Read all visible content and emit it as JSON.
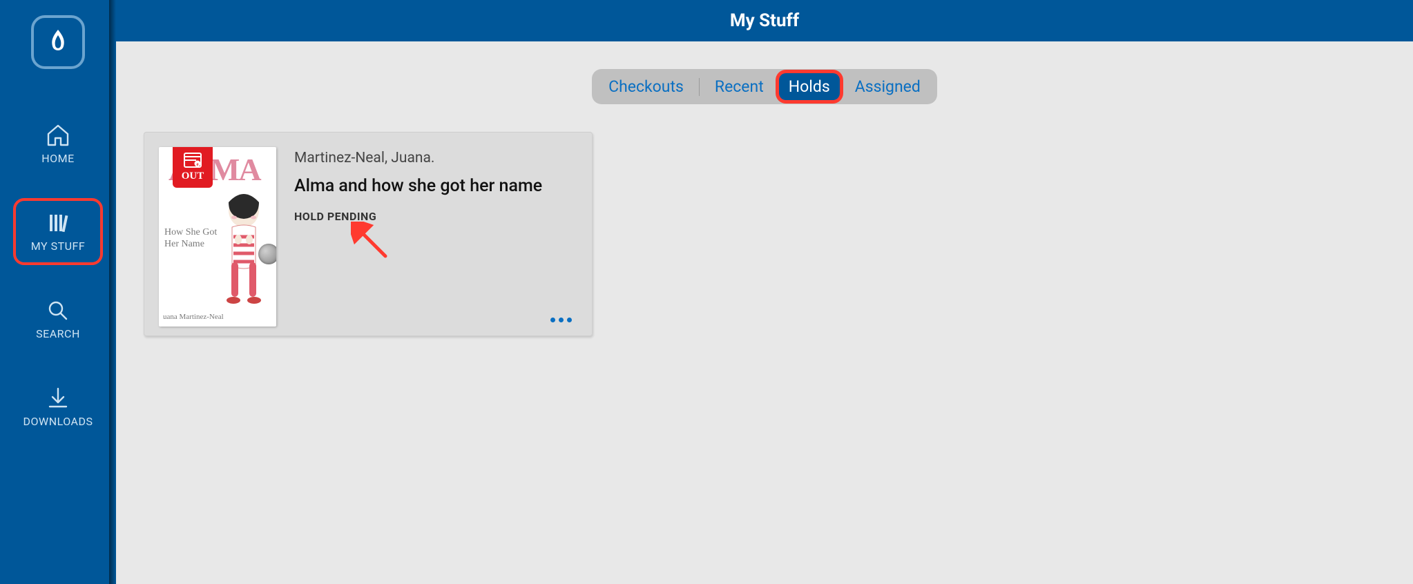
{
  "header": {
    "title": "My Stuff"
  },
  "sidebar": {
    "items": [
      {
        "id": "home",
        "label": "HOME"
      },
      {
        "id": "mystuff",
        "label": "MY STUFF"
      },
      {
        "id": "search",
        "label": "SEARCH"
      },
      {
        "id": "downloads",
        "label": "DOWNLOADS"
      }
    ],
    "active": "mystuff"
  },
  "tabs": {
    "items": [
      {
        "id": "checkouts",
        "label": "Checkouts"
      },
      {
        "id": "recent",
        "label": "Recent"
      },
      {
        "id": "holds",
        "label": "Holds"
      },
      {
        "id": "assigned",
        "label": "Assigned"
      }
    ],
    "active": "holds"
  },
  "hold": {
    "badge": "OUT",
    "author": "Martinez-Neal, Juana.",
    "title": "Alma and how she got her name",
    "status": "HOLD PENDING",
    "cover": {
      "title_word": "ALMA",
      "subtitle": "How She Got Her Name",
      "author_line": "uana Martinez-Neal"
    }
  }
}
